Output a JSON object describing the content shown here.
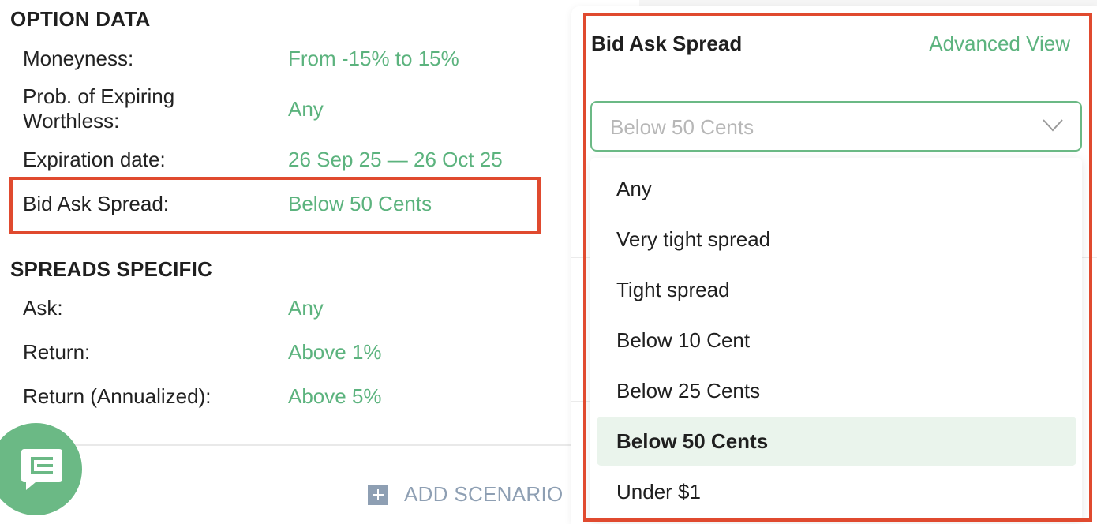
{
  "option_data": {
    "title": "OPTION DATA",
    "rows": [
      {
        "label": "Moneyness:",
        "value": "From -15% to 15%"
      },
      {
        "label": "Prob. of Expiring Worthless:",
        "value": "Any"
      },
      {
        "label": "Expiration date:",
        "value": "26 Sep 25 — 26 Oct 25"
      },
      {
        "label": "Bid Ask Spread:",
        "value": "Below 50 Cents"
      }
    ]
  },
  "spreads_specific": {
    "title": "SPREADS SPECIFIC",
    "rows": [
      {
        "label": "Ask:",
        "value": "Any"
      },
      {
        "label": "Return:",
        "value": "Above 1%"
      },
      {
        "label": "Return (Annualized):",
        "value": "Above 5%"
      }
    ]
  },
  "footer": {
    "add_scenario_label": "ADD SCENARIO"
  },
  "popover": {
    "title": "Bid Ask Spread",
    "advanced_view_label": "Advanced View",
    "select": {
      "selected_value": "Below 50 Cents"
    },
    "options": [
      {
        "label": "Any"
      },
      {
        "label": "Very tight spread"
      },
      {
        "label": "Tight spread"
      },
      {
        "label": "Below 10 Cent"
      },
      {
        "label": "Below 25 Cents"
      },
      {
        "label": "Below 50 Cents",
        "selected": true
      },
      {
        "label": "Under $1"
      }
    ]
  },
  "colors": {
    "accent_green": "#5cb37e",
    "highlight_red": "#e04a2f",
    "muted_blue": "#8e9fb3",
    "selected_bg": "#eaf4ec"
  },
  "icons": {
    "chat": "chat-icon",
    "add": "plus-square-icon",
    "chevron": "chevron-down-icon"
  }
}
